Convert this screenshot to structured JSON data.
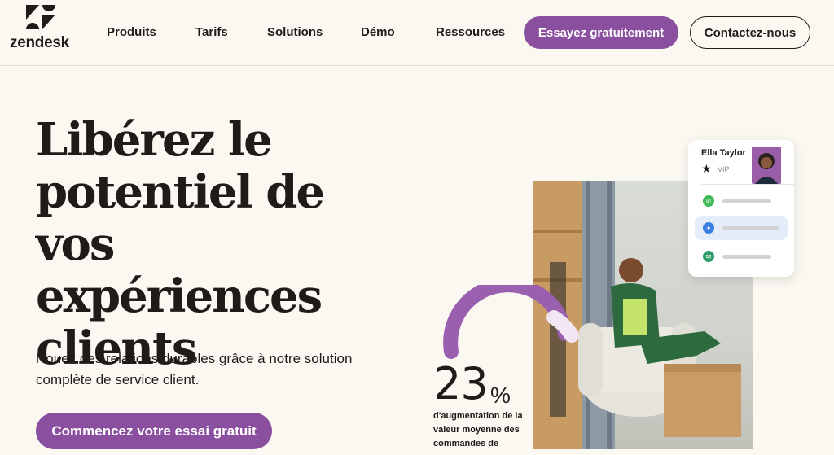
{
  "nav": {
    "logo_text": "zendesk",
    "items": [
      {
        "label": "Produits"
      },
      {
        "label": "Tarifs"
      },
      {
        "label": "Solutions"
      },
      {
        "label": "Démo"
      },
      {
        "label": "Ressources"
      }
    ],
    "try_button": "Essayez gratuitement",
    "contact_button": "Contactez-nous"
  },
  "hero": {
    "title": "Libérez le potentiel de vos expériences clients",
    "subtitle": "Nouez des relations durables grâce à notre solution complète de service client.",
    "cta": "Commencez votre essai gratuit"
  },
  "profile_card": {
    "name": "Ella Taylor",
    "tier": "VIP",
    "channels": [
      {
        "icon": "whatsapp-icon",
        "color": "#3fb857",
        "progress": 0.5
      },
      {
        "icon": "messenger-icon",
        "color": "#3a7fe0",
        "progress": 0.7
      },
      {
        "icon": "mail-icon",
        "color": "#2f9e6a",
        "progress": 0.5
      }
    ]
  },
  "stat": {
    "value": "23",
    "unit": "%",
    "caption": "d'augmentation de la valeur moyenne des commandes de"
  },
  "colors": {
    "brand_purple": "#8b4fa0",
    "background": "#fbf8f2"
  }
}
